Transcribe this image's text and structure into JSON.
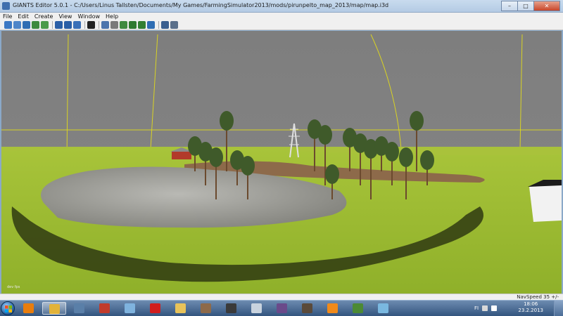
{
  "window": {
    "title": "GIANTS Editor 5.0.1 - C:/Users/Linus Tallsten/Documents/My Games/FarmingSimulator2013/mods/pirunpelto_map_2013/map/map.i3d",
    "minimize_label": "–",
    "maximize_label": "□",
    "close_label": "✕"
  },
  "menu": [
    {
      "name": "menu-file",
      "label": "File"
    },
    {
      "name": "menu-edit",
      "label": "Edit"
    },
    {
      "name": "menu-create",
      "label": "Create"
    },
    {
      "name": "menu-view",
      "label": "View"
    },
    {
      "name": "menu-window",
      "label": "Window"
    },
    {
      "name": "menu-help",
      "label": "Help"
    }
  ],
  "toolbar": {
    "buttons": [
      {
        "name": "new-icon",
        "color": "#3b78c4"
      },
      {
        "name": "open-icon",
        "color": "#4f86c9"
      },
      {
        "name": "save-icon",
        "color": "#2f6db3"
      },
      {
        "name": "save-as-icon",
        "color": "#3d8a3d"
      },
      {
        "name": "export-icon",
        "color": "#4a9a4a"
      },
      {
        "name": "sep"
      },
      {
        "name": "undo-icon",
        "color": "#2a5ea6"
      },
      {
        "name": "redo-icon",
        "color": "#2a5ea6"
      },
      {
        "name": "refresh-icon",
        "color": "#3a70b8"
      },
      {
        "name": "sep"
      },
      {
        "name": "play-icon",
        "color": "#222222"
      },
      {
        "name": "sep"
      },
      {
        "name": "select-tool-icon",
        "color": "#4b74ad"
      },
      {
        "name": "magnet-icon",
        "color": "#7a7a7a"
      },
      {
        "name": "terrain-sculpt-icon",
        "color": "#3f8a3f"
      },
      {
        "name": "terrain-paint-icon",
        "color": "#2f7a2f"
      },
      {
        "name": "foliage-paint-icon",
        "color": "#327f32"
      },
      {
        "name": "placement-icon",
        "color": "#2f6db3"
      },
      {
        "name": "sep"
      },
      {
        "name": "scene-graph-icon",
        "color": "#3b5f8f"
      },
      {
        "name": "settings-icon",
        "color": "#5a6f8a"
      }
    ]
  },
  "status": {
    "navspeed_text": "NavSpeed 35 +/-",
    "viewport_corner_text": "dev fps"
  },
  "taskbar": {
    "apps": [
      {
        "name": "taskbar-blender",
        "icon": "blender-icon",
        "color": "#e87d0d"
      },
      {
        "name": "taskbar-giants-editor",
        "icon": "giants-editor-icon",
        "color": "#e2b33a",
        "active": true
      },
      {
        "name": "taskbar-notepad",
        "icon": "notepad-icon",
        "color": "#5a7fa8"
      },
      {
        "name": "taskbar-tractor",
        "icon": "tractor-icon",
        "color": "#c23b2b"
      },
      {
        "name": "taskbar-folders",
        "icon": "folder-icon",
        "color": "#7fb3de"
      },
      {
        "name": "taskbar-opera",
        "icon": "opera-icon",
        "color": "#d11d1d"
      },
      {
        "name": "taskbar-explorer",
        "icon": "explorer-icon",
        "color": "#e8c35a"
      },
      {
        "name": "taskbar-paint",
        "icon": "paint-icon",
        "color": "#8d6a4a"
      },
      {
        "name": "taskbar-3dsmax",
        "icon": "3dsmax-icon",
        "color": "#3a3a3a"
      },
      {
        "name": "taskbar-calculator",
        "icon": "calculator-icon",
        "color": "#c9d3de"
      },
      {
        "name": "taskbar-games",
        "icon": "games-icon",
        "color": "#6a4a8a"
      },
      {
        "name": "taskbar-texture",
        "icon": "texture-icon",
        "color": "#5a4a3a"
      },
      {
        "name": "taskbar-vlc",
        "icon": "vlc-icon",
        "color": "#f08a1a"
      },
      {
        "name": "taskbar-minecraft",
        "icon": "minecraft-icon",
        "color": "#4c8a34"
      },
      {
        "name": "taskbar-misc",
        "icon": "misc-icon",
        "color": "#7ab8e0"
      }
    ],
    "language": "FI",
    "time": "18:06",
    "date": "23.2.2013"
  }
}
